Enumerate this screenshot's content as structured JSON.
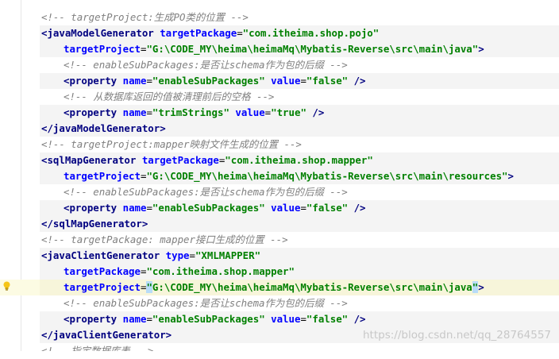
{
  "lines": [
    {
      "indent": 1,
      "tokens": [
        {
          "k": "c",
          "t": "<!-- targetProject:生成PO类的位置 -->"
        }
      ]
    },
    {
      "indent": 1,
      "bg": true,
      "tokens": [
        {
          "k": "t",
          "t": "<javaModelGenerator "
        },
        {
          "k": "a",
          "t": "targetPackage"
        },
        {
          "k": "p",
          "t": "="
        },
        {
          "k": "v",
          "t": "\"com.itheima.shop.pojo\""
        }
      ]
    },
    {
      "indent": 2,
      "bg": true,
      "tokens": [
        {
          "k": "a",
          "t": "targetProject"
        },
        {
          "k": "p",
          "t": "="
        },
        {
          "k": "v",
          "t": "\"G:\\CODE_MY\\heima\\heimaMq\\Mybatis-Reverse\\src\\main\\java\""
        },
        {
          "k": "t",
          "t": ">"
        }
      ]
    },
    {
      "indent": 2,
      "tokens": [
        {
          "k": "c",
          "t": "<!-- enableSubPackages:是否让schema作为包的后缀 -->"
        }
      ]
    },
    {
      "indent": 2,
      "bg": true,
      "tokens": [
        {
          "k": "t",
          "t": "<property "
        },
        {
          "k": "a",
          "t": "name"
        },
        {
          "k": "p",
          "t": "="
        },
        {
          "k": "v",
          "t": "\"enableSubPackages\" "
        },
        {
          "k": "a",
          "t": "value"
        },
        {
          "k": "p",
          "t": "="
        },
        {
          "k": "v",
          "t": "\"false\" "
        },
        {
          "k": "t",
          "t": "/>"
        }
      ]
    },
    {
      "indent": 2,
      "tokens": [
        {
          "k": "c",
          "t": "<!-- 从数据库返回的值被清理前后的空格 -->"
        }
      ]
    },
    {
      "indent": 2,
      "bg": true,
      "tokens": [
        {
          "k": "t",
          "t": "<property "
        },
        {
          "k": "a",
          "t": "name"
        },
        {
          "k": "p",
          "t": "="
        },
        {
          "k": "v",
          "t": "\"trimStrings\" "
        },
        {
          "k": "a",
          "t": "value"
        },
        {
          "k": "p",
          "t": "="
        },
        {
          "k": "v",
          "t": "\"true\" "
        },
        {
          "k": "t",
          "t": "/>"
        }
      ]
    },
    {
      "indent": 1,
      "bg": true,
      "tokens": [
        {
          "k": "t",
          "t": "</javaModelGenerator>"
        }
      ]
    },
    {
      "indent": 1,
      "tokens": [
        {
          "k": "c",
          "t": "<!-- targetProject:mapper映射文件生成的位置 -->"
        }
      ]
    },
    {
      "indent": 1,
      "bg": true,
      "tokens": [
        {
          "k": "t",
          "t": "<sqlMapGenerator "
        },
        {
          "k": "a",
          "t": "targetPackage"
        },
        {
          "k": "p",
          "t": "="
        },
        {
          "k": "v",
          "t": "\"com.itheima.shop.mapper\""
        }
      ]
    },
    {
      "indent": 2,
      "bg": true,
      "tokens": [
        {
          "k": "a",
          "t": "targetProject"
        },
        {
          "k": "p",
          "t": "="
        },
        {
          "k": "v",
          "t": "\"G:\\CODE_MY\\heima\\heimaMq\\Mybatis-Reverse\\src\\main\\resources\""
        },
        {
          "k": "t",
          "t": ">"
        }
      ]
    },
    {
      "indent": 2,
      "tokens": [
        {
          "k": "c",
          "t": "<!-- enableSubPackages:是否让schema作为包的后缀 -->"
        }
      ]
    },
    {
      "indent": 2,
      "bg": true,
      "tokens": [
        {
          "k": "t",
          "t": "<property "
        },
        {
          "k": "a",
          "t": "name"
        },
        {
          "k": "p",
          "t": "="
        },
        {
          "k": "v",
          "t": "\"enableSubPackages\" "
        },
        {
          "k": "a",
          "t": "value"
        },
        {
          "k": "p",
          "t": "="
        },
        {
          "k": "v",
          "t": "\"false\" "
        },
        {
          "k": "t",
          "t": "/>"
        }
      ]
    },
    {
      "indent": 1,
      "bg": true,
      "tokens": [
        {
          "k": "t",
          "t": "</sqlMapGenerator>"
        }
      ]
    },
    {
      "indent": 1,
      "tokens": [
        {
          "k": "c",
          "t": "<!-- targetPackage: mapper接口生成的位置 -->"
        }
      ]
    },
    {
      "indent": 1,
      "bg": true,
      "tokens": [
        {
          "k": "t",
          "t": "<javaClientGenerator "
        },
        {
          "k": "a",
          "t": "type"
        },
        {
          "k": "p",
          "t": "="
        },
        {
          "k": "v",
          "t": "\"XMLMAPPER\""
        }
      ]
    },
    {
      "indent": 2,
      "bg": true,
      "tokens": [
        {
          "k": "a",
          "t": "targetPackage"
        },
        {
          "k": "p",
          "t": "="
        },
        {
          "k": "v",
          "t": "\"com.itheima.shop.mapper\""
        }
      ]
    },
    {
      "indent": 2,
      "bg": true,
      "current": true,
      "tokens": [
        {
          "k": "a",
          "t": "targetProject"
        },
        {
          "k": "p",
          "t": "="
        },
        {
          "k": "v hlq",
          "t": "\""
        },
        {
          "k": "v",
          "t": "G:\\CODE_MY\\heima\\heimaMq\\Mybatis-Reverse\\src\\main\\java"
        },
        {
          "k": "v hlq",
          "t": "\""
        },
        {
          "k": "t",
          "t": ">"
        }
      ]
    },
    {
      "indent": 2,
      "tokens": [
        {
          "k": "c",
          "t": "<!-- enableSubPackages:是否让schema作为包的后缀 -->"
        }
      ]
    },
    {
      "indent": 2,
      "bg": true,
      "tokens": [
        {
          "k": "t",
          "t": "<property "
        },
        {
          "k": "a",
          "t": "name"
        },
        {
          "k": "p",
          "t": "="
        },
        {
          "k": "v",
          "t": "\"enableSubPackages\" "
        },
        {
          "k": "a",
          "t": "value"
        },
        {
          "k": "p",
          "t": "="
        },
        {
          "k": "v",
          "t": "\"false\" "
        },
        {
          "k": "t",
          "t": "/>"
        }
      ]
    },
    {
      "indent": 1,
      "bg": true,
      "tokens": [
        {
          "k": "t",
          "t": "</javaClientGenerator>"
        }
      ]
    },
    {
      "indent": 1,
      "cut": true,
      "tokens": [
        {
          "k": "c",
          "t": "<!-- 指定数据库表 -->"
        }
      ]
    }
  ],
  "watermark": "https://blog.csdn.net/qq_28764557",
  "icons": {
    "gutter": "lightbulb-icon"
  },
  "colors": {
    "tag": "#000080",
    "attr": "#0000ff",
    "value": "#008000",
    "comment": "#808080",
    "current_line": "#fcfbe3"
  }
}
